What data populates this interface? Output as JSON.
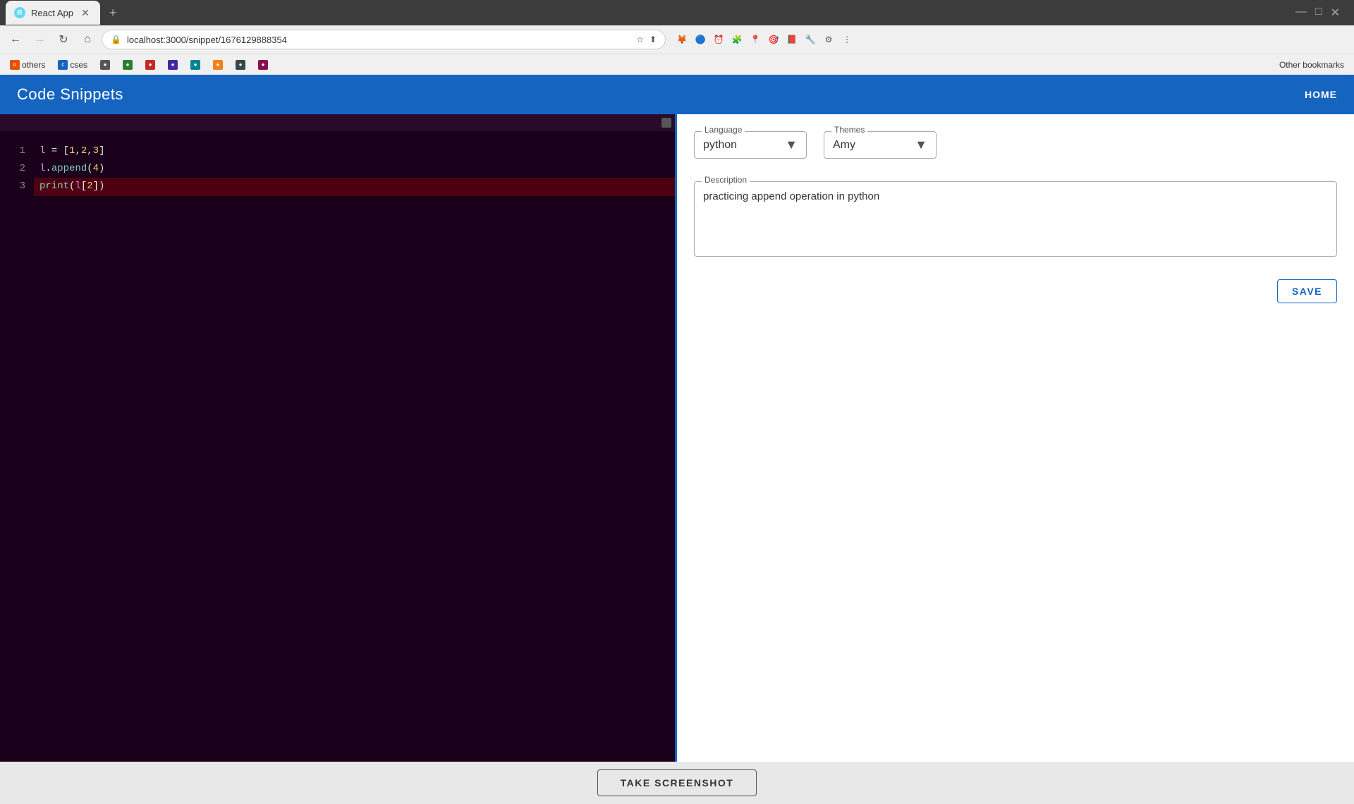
{
  "browser": {
    "tab_title": "React App",
    "url": "localhost:3000/snippet/1676129888354",
    "new_tab_label": "+",
    "back_disabled": false,
    "forward_disabled": true
  },
  "bookmarks": {
    "items": [
      {
        "label": "others",
        "favicon": "o"
      },
      {
        "label": "cses",
        "favicon": "c"
      },
      {
        "label": "",
        "favicon": ""
      },
      {
        "label": "",
        "favicon": ""
      },
      {
        "label": "",
        "favicon": ""
      },
      {
        "label": "",
        "favicon": ""
      },
      {
        "label": "",
        "favicon": ""
      },
      {
        "label": "",
        "favicon": ""
      },
      {
        "label": "",
        "favicon": ""
      },
      {
        "label": "",
        "favicon": ""
      }
    ]
  },
  "app": {
    "title": "Code Snippets",
    "nav_home": "HOME"
  },
  "editor": {
    "lines": [
      {
        "number": "1",
        "code": "l = [1,2,3]",
        "highlighted": false
      },
      {
        "number": "2",
        "code": "l.append(4)",
        "highlighted": false
      },
      {
        "number": "3",
        "code": "print(l[2])",
        "highlighted": true
      }
    ]
  },
  "config": {
    "language_label": "Language",
    "language_value": "python",
    "themes_label": "Themes",
    "themes_value": "Amy",
    "description_label": "Description",
    "description_value": "practicing append operation in python",
    "save_label": "SAVE"
  },
  "footer": {
    "screenshot_label": "TAKE SCREENSHOT"
  }
}
